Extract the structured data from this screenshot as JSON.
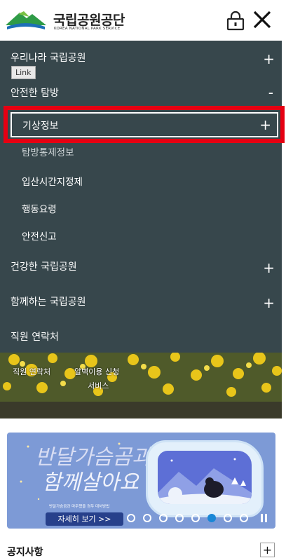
{
  "header": {
    "logo_ko": "국립공원공단",
    "logo_en": "KOREA NATIONAL PARK SERVICE",
    "lock_icon": "lock-icon",
    "close_icon": "close-icon"
  },
  "menu": {
    "items": [
      {
        "label": "우리나라 국립공원",
        "sign": "+"
      },
      {
        "label": "안전한 탐방",
        "sign": "-"
      },
      {
        "label": "건강한 국립공원",
        "sign": "+"
      },
      {
        "label": "함께하는 국립공원",
        "sign": "+"
      },
      {
        "label": "직원 연락처",
        "sign": ""
      }
    ],
    "link_badge": "Link",
    "highlighted": {
      "label": "기상정보",
      "sign": "+"
    },
    "hidden_partial": "탐방통제정보",
    "sub_items": [
      "입산시간지정제",
      "행동요령",
      "안전신고"
    ],
    "highlight_color": "#e60012",
    "background": "#37474c"
  },
  "flower_banner": {
    "links": [
      "직원 연락처",
      "알벽이용 신청",
      "서비스"
    ]
  },
  "promo": {
    "title_line1": "반달가슴곰과",
    "title_line2": "함께살아요",
    "subtitle": "반달가슴곰과 마주쳤을 경우 대처방법",
    "button": "자세히 보기 >>",
    "slide_count": 8,
    "active_slide": 6,
    "pause_icon": "pause-icon"
  },
  "notice": {
    "title": "공지사항",
    "more": "+"
  }
}
